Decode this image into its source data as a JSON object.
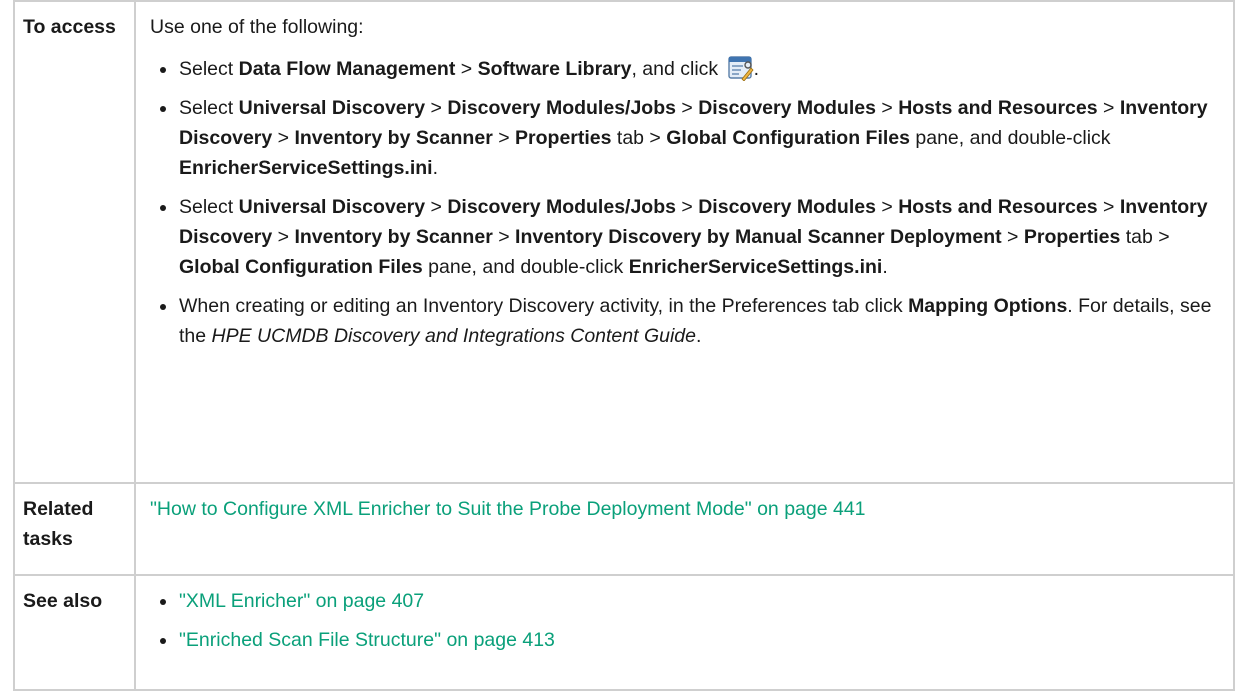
{
  "access": {
    "label": "To access",
    "intro": "Use one of the following:",
    "item1": {
      "t1": "Select ",
      "b1": "Data Flow Management",
      "t2": " > ",
      "b2": "Software Library",
      "t3": ", and click ",
      "t4": ".",
      "icon": "edit-settings-icon"
    },
    "item2": {
      "t1": "Select ",
      "b1": "Universal Discovery",
      "t2": " > ",
      "b2": "Discovery Modules/Jobs",
      "t3": " > ",
      "b3": "Discovery Modules",
      "t4": "  > ",
      "b4": "Hosts and Resources",
      "t5": " > ",
      "b5": "Inventory Discovery",
      "t6": " > ",
      "b6": "Inventory by Scanner",
      "t7": " > ",
      "b7": "Properties",
      "t8": " tab > ",
      "b8": "Global Configuration Files",
      "t9": " pane, and double-click ",
      "b9": "EnricherServiceSettings.ini",
      "t10": "."
    },
    "item3": {
      "t1": "Select ",
      "b1": "Universal Discovery",
      "t2": " > ",
      "b2": "Discovery Modules/Jobs",
      "t3": " > ",
      "b3": "Discovery Modules",
      "t4": "  > ",
      "b4": "Hosts and Resources",
      "t5": " > ",
      "b5": "Inventory Discovery",
      "t6": " > ",
      "b6": "Inventory by Scanner",
      "t7": " > ",
      "b7": "Inventory Discovery by Manual Scanner Deployment",
      "t8": " > ",
      "b8": "Properties",
      "t9": " tab > ",
      "b9": "Global Configuration Files",
      "t10": " pane, and double-click ",
      "b10": "EnricherServiceSettings.ini",
      "t11": "."
    },
    "item4": {
      "t1": "When creating or editing an Inventory Discovery activity, in the Preferences tab click ",
      "b1": "Mapping Options",
      "t2": ". For details, see the ",
      "i1": "HPE UCMDB Discovery and Integrations Content Guide",
      "t3": "."
    }
  },
  "related": {
    "label": "Related tasks",
    "link": "\"How to Configure XML Enricher to Suit the Probe Deployment Mode\" on page 441"
  },
  "see": {
    "label": "See also",
    "links": [
      "\"XML Enricher\" on page 407",
      "\"Enriched Scan File Structure\" on page 413"
    ]
  },
  "colors": {
    "link": "#0aa07a",
    "border": "#cfcfcf"
  }
}
